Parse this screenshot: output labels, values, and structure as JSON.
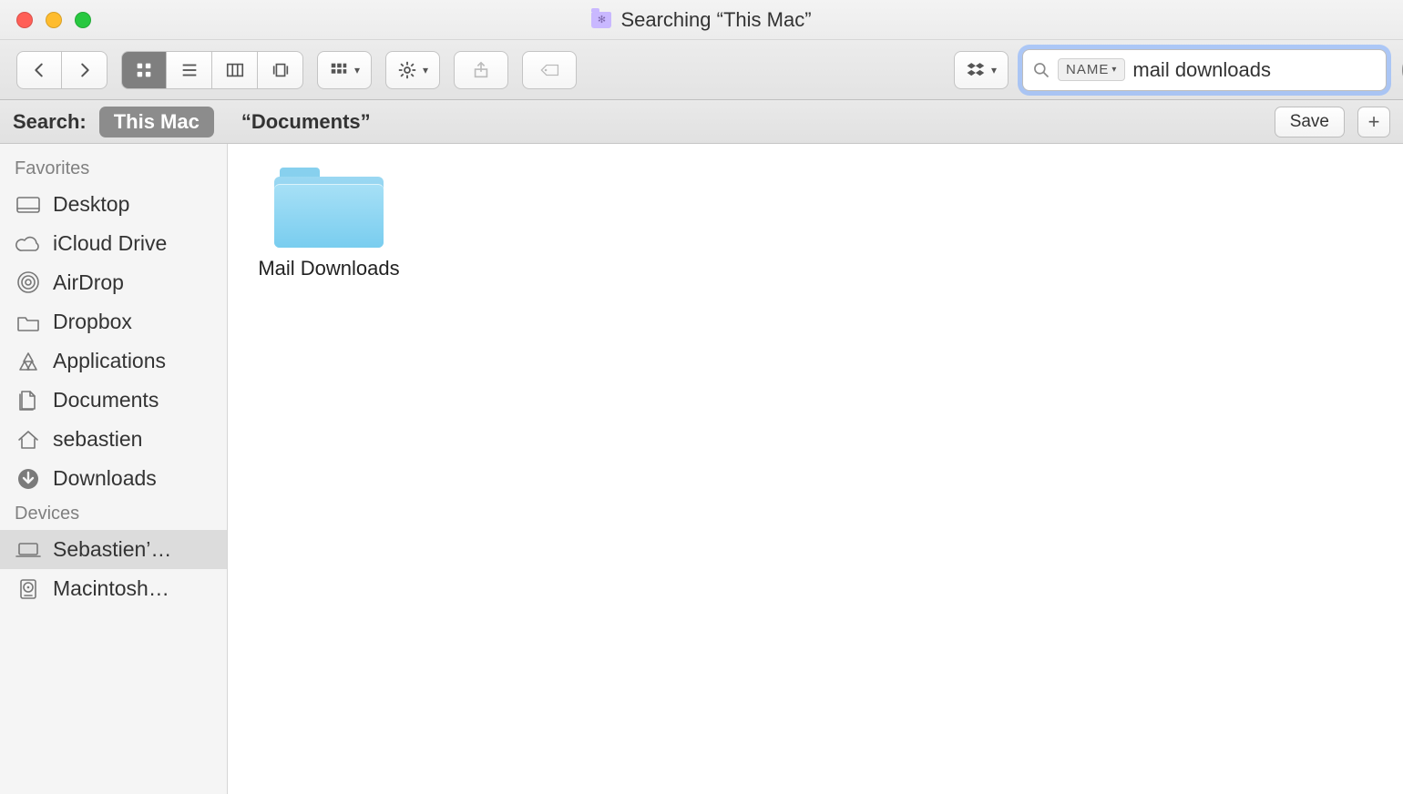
{
  "window": {
    "title": "Searching “This Mac”"
  },
  "search": {
    "token": "NAME",
    "value": "mail downloads"
  },
  "scope": {
    "label": "Search:",
    "options": [
      {
        "label": "This Mac",
        "active": true
      },
      {
        "label": "“Documents”",
        "active": false
      }
    ],
    "save": "Save",
    "plus": "+"
  },
  "sidebar": {
    "sections": [
      {
        "header": "Favorites",
        "items": [
          {
            "icon": "desktop",
            "label": "Desktop",
            "selected": false
          },
          {
            "icon": "cloud",
            "label": "iCloud Drive",
            "selected": false
          },
          {
            "icon": "airdrop",
            "label": "AirDrop",
            "selected": false
          },
          {
            "icon": "folder",
            "label": "Dropbox",
            "selected": false
          },
          {
            "icon": "apps",
            "label": "Applications",
            "selected": false
          },
          {
            "icon": "documents",
            "label": "Documents",
            "selected": false
          },
          {
            "icon": "home",
            "label": "sebastien",
            "selected": false
          },
          {
            "icon": "download",
            "label": "Downloads",
            "selected": false
          }
        ]
      },
      {
        "header": "Devices",
        "items": [
          {
            "icon": "laptop",
            "label": "Sebastien’…",
            "selected": true
          },
          {
            "icon": "hdd",
            "label": "Macintosh…",
            "selected": false
          }
        ]
      }
    ]
  },
  "results": [
    {
      "type": "folder",
      "label": "Mail Downloads"
    }
  ]
}
